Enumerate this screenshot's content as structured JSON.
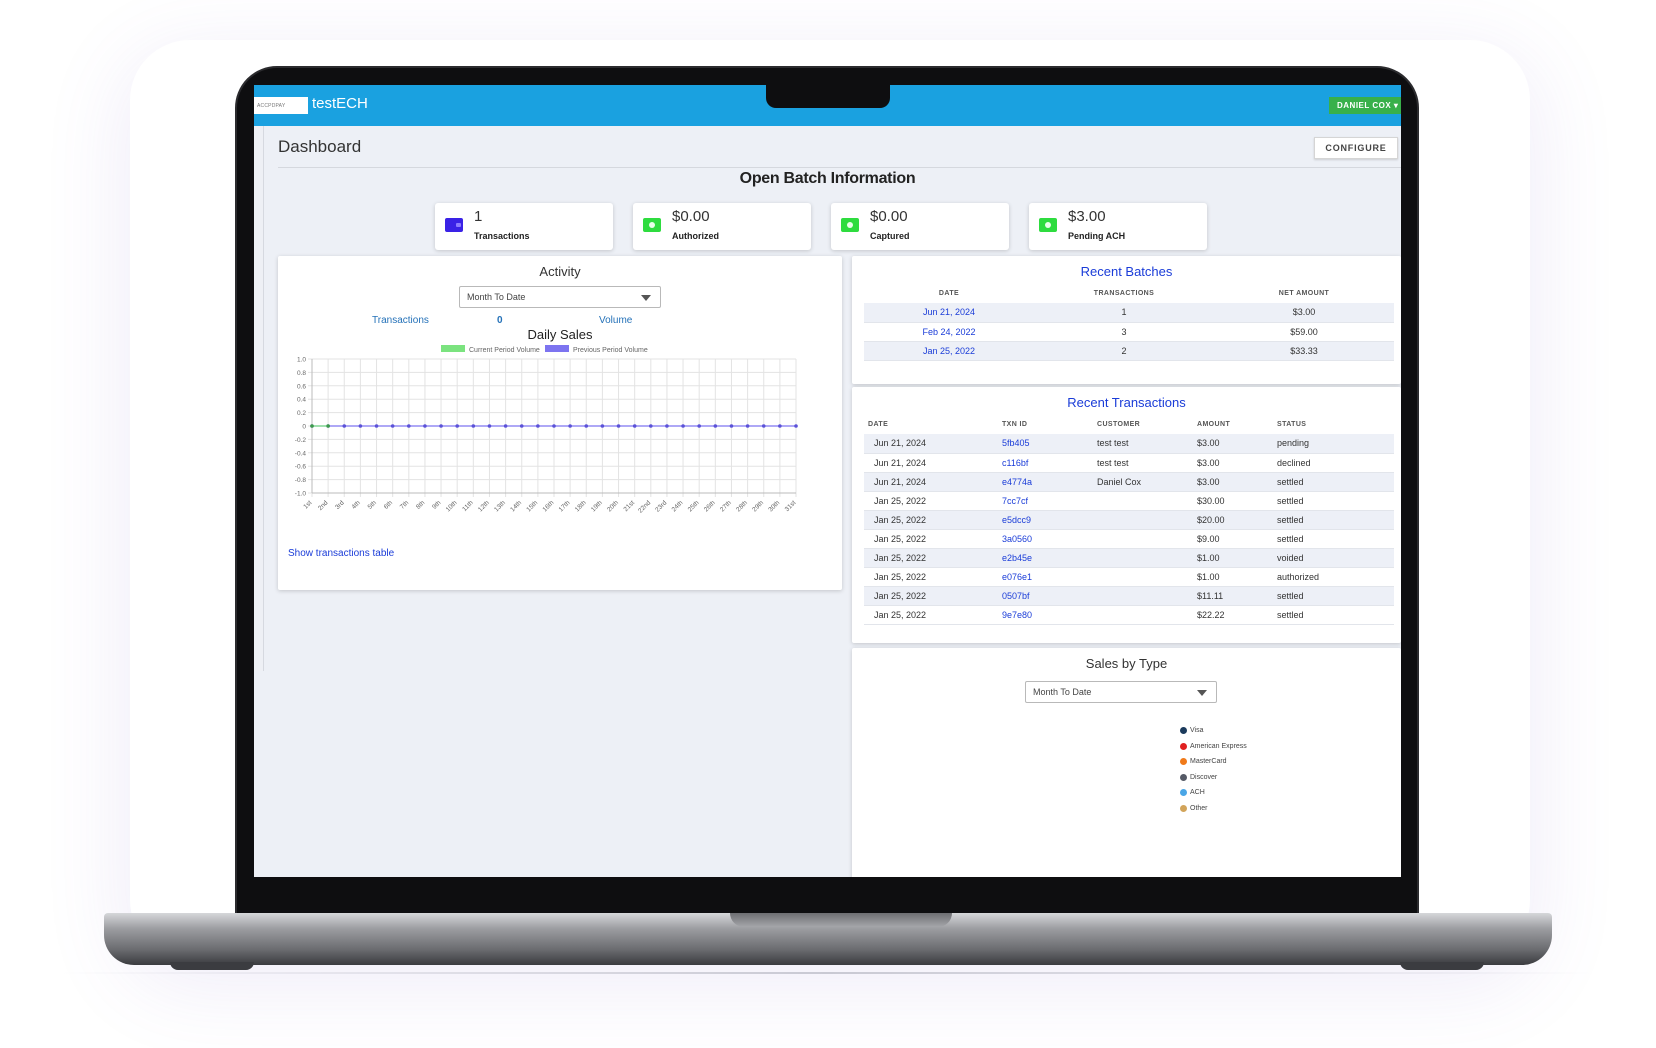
{
  "app": {
    "logo_text": "ACCPDPAY",
    "title": "testECH",
    "user_label": "DANIEL COX ▾"
  },
  "page": {
    "title": "Dashboard",
    "configure_label": "CONFIGURE"
  },
  "open_batch": {
    "heading": "Open Batch Information",
    "cards": [
      {
        "value": "1",
        "label": "Transactions",
        "icon": "wallet-icon"
      },
      {
        "value": "$0.00",
        "label": "Authorized",
        "icon": "cash-icon"
      },
      {
        "value": "$0.00",
        "label": "Captured",
        "icon": "cash-icon"
      },
      {
        "value": "$3.00",
        "label": "Pending ACH",
        "icon": "cash-icon"
      }
    ]
  },
  "activity": {
    "title": "Activity",
    "range": "Month To Date",
    "transactions_label": "Transactions",
    "transactions_value": "0",
    "volume_label": "Volume",
    "show_table_link": "Show transactions table"
  },
  "chart_data": {
    "type": "line",
    "title": "Daily Sales",
    "categories": [
      "1st",
      "2nd",
      "3rd",
      "4th",
      "5th",
      "6th",
      "7th",
      "8th",
      "9th",
      "10th",
      "11th",
      "12th",
      "13th",
      "14th",
      "15th",
      "16th",
      "17th",
      "18th",
      "19th",
      "20th",
      "21st",
      "22nd",
      "23rd",
      "24th",
      "25th",
      "26th",
      "27th",
      "28th",
      "29th",
      "30th",
      "31st"
    ],
    "series": [
      {
        "name": "Current Period Volume",
        "color": "#7be37f",
        "values": [
          0,
          0
        ]
      },
      {
        "name": "Previous Period Volume",
        "color": "#7d74f0",
        "values": [
          0,
          0,
          0,
          0,
          0,
          0,
          0,
          0,
          0,
          0,
          0,
          0,
          0,
          0,
          0,
          0,
          0,
          0,
          0,
          0,
          0,
          0,
          0,
          0,
          0,
          0,
          0,
          0,
          0,
          0,
          0
        ]
      }
    ],
    "yticks": [
      "1.0",
      "0.8",
      "0.6",
      "0.4",
      "0.2",
      "0",
      "-0.2",
      "-0.4",
      "-0.6",
      "-0.8",
      "-1.0"
    ],
    "ylim": [
      -1,
      1
    ],
    "grid": true,
    "legend": "top"
  },
  "recent_batches": {
    "title": "Recent Batches",
    "headers": [
      "DATE",
      "TRANSACTIONS",
      "NET AMOUNT"
    ],
    "rows": [
      {
        "date": "Jun 21, 2024",
        "transactions": "1",
        "net_amount": "$3.00"
      },
      {
        "date": "Feb 24, 2022",
        "transactions": "3",
        "net_amount": "$59.00"
      },
      {
        "date": "Jan 25, 2022",
        "transactions": "2",
        "net_amount": "$33.33"
      }
    ]
  },
  "recent_transactions": {
    "title": "Recent Transactions",
    "headers": [
      "DATE",
      "TXN ID",
      "CUSTOMER",
      "AMOUNT",
      "STATUS"
    ],
    "rows": [
      {
        "date": "Jun 21, 2024",
        "txn": "5fb405",
        "customer": "test test",
        "amount": "$3.00",
        "status": "pending"
      },
      {
        "date": "Jun 21, 2024",
        "txn": "c116bf",
        "customer": "test test",
        "amount": "$3.00",
        "status": "declined"
      },
      {
        "date": "Jun 21, 2024",
        "txn": "e4774a",
        "customer": "Daniel Cox",
        "amount": "$3.00",
        "status": "settled"
      },
      {
        "date": "Jan 25, 2022",
        "txn": "7cc7cf",
        "customer": "",
        "amount": "$30.00",
        "status": "settled"
      },
      {
        "date": "Jan 25, 2022",
        "txn": "e5dcc9",
        "customer": "",
        "amount": "$20.00",
        "status": "settled"
      },
      {
        "date": "Jan 25, 2022",
        "txn": "3a0560",
        "customer": "",
        "amount": "$9.00",
        "status": "settled"
      },
      {
        "date": "Jan 25, 2022",
        "txn": "e2b45e",
        "customer": "",
        "amount": "$1.00",
        "status": "voided"
      },
      {
        "date": "Jan 25, 2022",
        "txn": "e076e1",
        "customer": "",
        "amount": "$1.00",
        "status": "authorized"
      },
      {
        "date": "Jan 25, 2022",
        "txn": "0507bf",
        "customer": "",
        "amount": "$11.11",
        "status": "settled"
      },
      {
        "date": "Jan 25, 2022",
        "txn": "9e7e80",
        "customer": "",
        "amount": "$22.22",
        "status": "settled"
      }
    ]
  },
  "sales_by_type": {
    "title": "Sales by Type",
    "range": "Month To Date",
    "legend": [
      {
        "label": "Visa",
        "color": "#1b3a5c"
      },
      {
        "label": "American Express",
        "color": "#e02020"
      },
      {
        "label": "MasterCard",
        "color": "#f07a1a"
      },
      {
        "label": "Discover",
        "color": "#555a66"
      },
      {
        "label": "ACH",
        "color": "#4aa6e6"
      },
      {
        "label": "Other",
        "color": "#d2a45a"
      }
    ]
  }
}
